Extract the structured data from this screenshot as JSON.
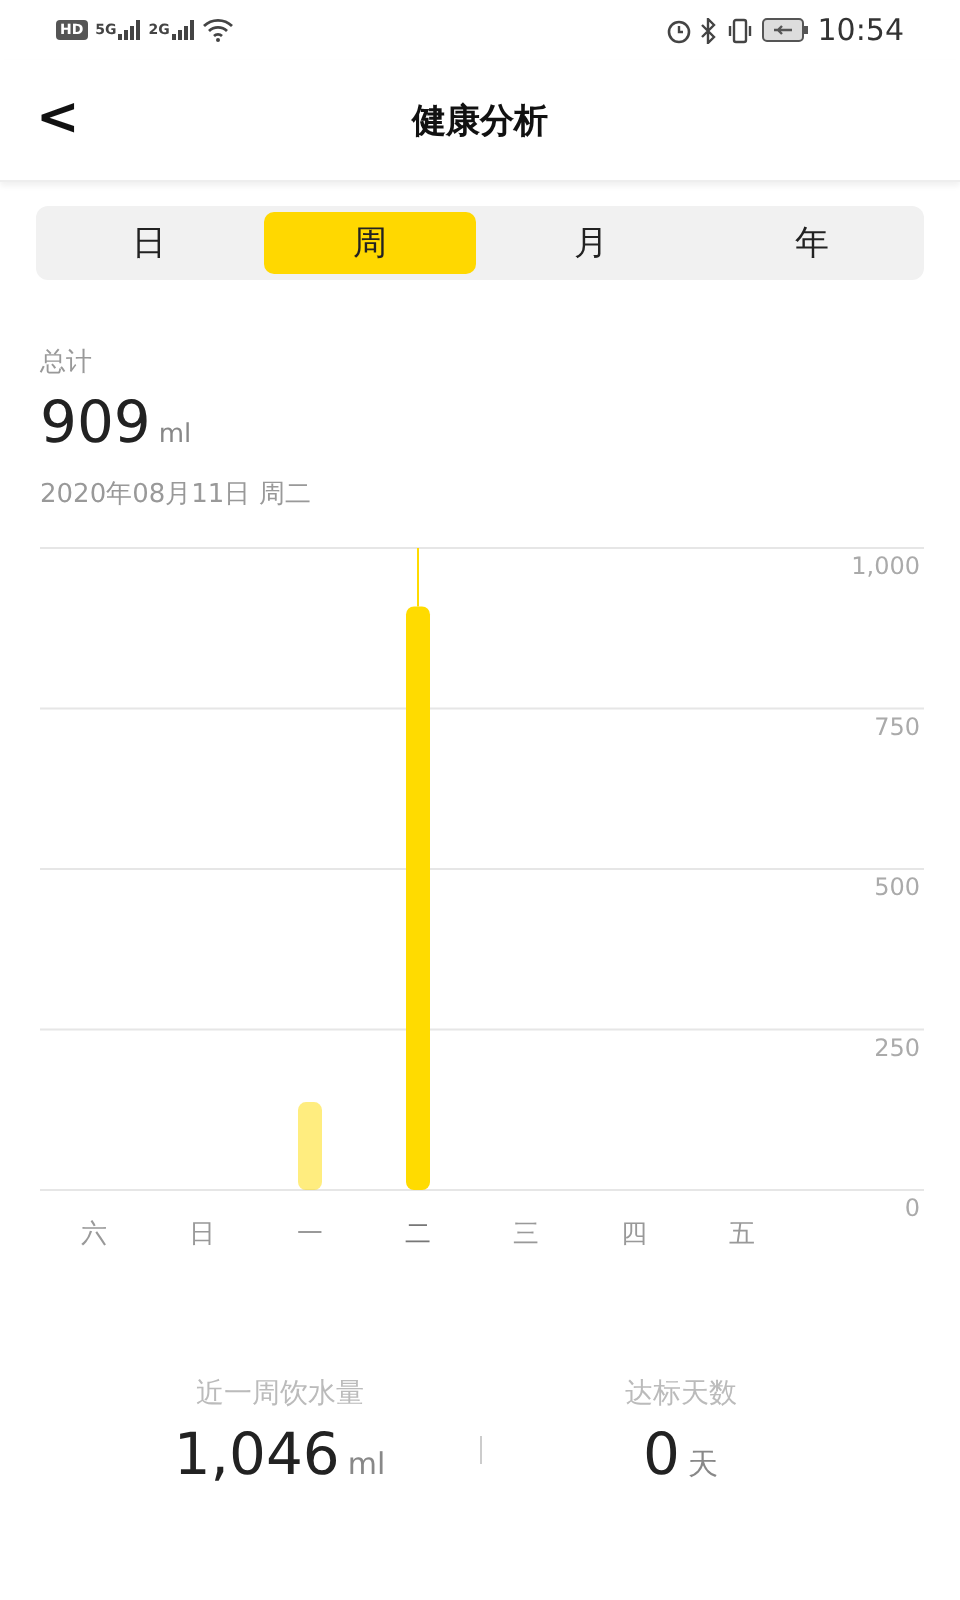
{
  "status_bar": {
    "badges": [
      "HD",
      "5G",
      "2G"
    ],
    "time": "10:54"
  },
  "header": {
    "back": "<",
    "title": "健康分析"
  },
  "tabs": [
    {
      "label": "日",
      "selected": false
    },
    {
      "label": "周",
      "selected": true
    },
    {
      "label": "月",
      "selected": false
    },
    {
      "label": "年",
      "selected": false
    }
  ],
  "summary": {
    "label": "总计",
    "value": "909",
    "unit": "ml",
    "date": "2020年08月11日 周二"
  },
  "chart": {
    "bars": [
      {
        "selected": false
      },
      {
        "selected": false
      },
      {
        "selected": false
      },
      {
        "selected": true
      },
      {
        "selected": false
      },
      {
        "selected": false
      },
      {
        "selected": false
      }
    ],
    "chart_data": {
      "type": "bar",
      "categories": [
        "六",
        "日",
        "一",
        "二",
        "三",
        "四",
        "五"
      ],
      "series": [
        {
          "color": "#ffdb00",
          "values": [
            0,
            0,
            137,
            909,
            0,
            0,
            0
          ]
        }
      ],
      "grid": true,
      "ylim": [
        0,
        1000
      ],
      "yticks": [
        0,
        250,
        500,
        750,
        {
          "value": 1000,
          "label": "1,000"
        }
      ]
    }
  },
  "stats": [
    {
      "label": "近一周饮水量",
      "value": "1,046",
      "unit": "ml"
    },
    {
      "label": "达标天数",
      "value": "0",
      "unit": "天"
    }
  ]
}
